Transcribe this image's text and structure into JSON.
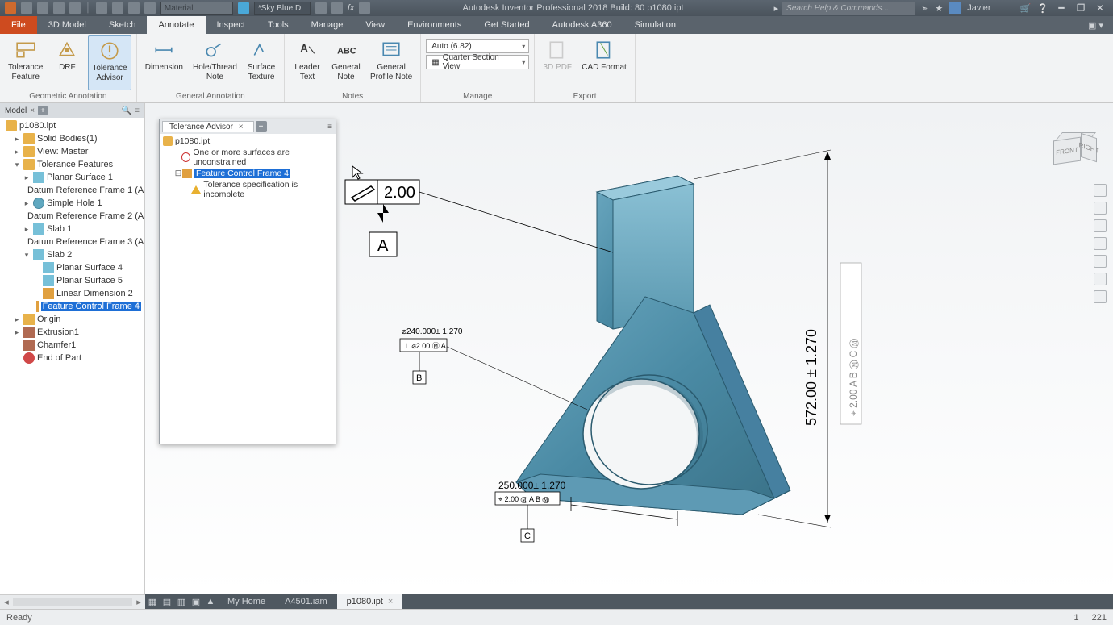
{
  "titlebar": {
    "material_placeholder": "Material",
    "appearance_label": "*Sky Blue D",
    "app_title": "Autodesk Inventor Professional 2018 Build: 80   p1080.ipt",
    "search_placeholder": "Search Help & Commands...",
    "user_name": "Javier"
  },
  "menu": {
    "file": "File",
    "tabs": [
      "3D Model",
      "Sketch",
      "Annotate",
      "Inspect",
      "Tools",
      "Manage",
      "View",
      "Environments",
      "Get Started",
      "Autodesk A360",
      "Simulation"
    ],
    "active_index": 2
  },
  "ribbon": {
    "groups": [
      {
        "label": "Geometric Annotation",
        "buttons": [
          {
            "name": "tolerance-feature",
            "label": "Tolerance\nFeature"
          },
          {
            "name": "drf",
            "label": "DRF"
          },
          {
            "name": "tolerance-advisor",
            "label": "Tolerance\nAdvisor",
            "active": true
          }
        ]
      },
      {
        "label": "General Annotation",
        "buttons": [
          {
            "name": "dimension",
            "label": "Dimension"
          },
          {
            "name": "hole-thread-note",
            "label": "Hole/Thread\nNote"
          },
          {
            "name": "surface-texture",
            "label": "Surface\nTexture"
          }
        ]
      },
      {
        "label": "Notes",
        "buttons": [
          {
            "name": "leader-text",
            "label": "Leader\nText"
          },
          {
            "name": "general-note",
            "label": "General\nNote"
          },
          {
            "name": "general-profile-note",
            "label": "General\nProfile Note"
          }
        ]
      },
      {
        "label": "Manage",
        "items": {
          "auto_dd": "Auto (6.82)",
          "section_dd": "Quarter Section View"
        }
      },
      {
        "label": "Export",
        "buttons": [
          {
            "name": "3d-pdf",
            "label": "3D PDF",
            "disabled": true
          },
          {
            "name": "cad-format",
            "label": "CAD Format"
          }
        ]
      }
    ]
  },
  "model_tree": {
    "tab": "Model",
    "root": "p1080.ipt",
    "nodes": [
      {
        "d": 1,
        "ico": "folder",
        "exp": ">",
        "label": "Solid Bodies(1)"
      },
      {
        "d": 1,
        "ico": "folder",
        "exp": ">",
        "label": "View: Master"
      },
      {
        "d": 1,
        "ico": "folder",
        "exp": "v",
        "label": "Tolerance Features"
      },
      {
        "d": 2,
        "ico": "planar",
        "exp": ">",
        "label": "Planar Surface 1"
      },
      {
        "d": 2,
        "ico": "drf",
        "exp": "",
        "label": "Datum Reference Frame 1 (A"
      },
      {
        "d": 2,
        "ico": "hole",
        "exp": ">",
        "label": "Simple Hole 1"
      },
      {
        "d": 2,
        "ico": "drf",
        "exp": "",
        "label": "Datum Reference Frame 2 (A"
      },
      {
        "d": 2,
        "ico": "slab",
        "exp": ">",
        "label": "Slab 1"
      },
      {
        "d": 2,
        "ico": "drf",
        "exp": "",
        "label": "Datum Reference Frame 3 (A"
      },
      {
        "d": 2,
        "ico": "slab",
        "exp": "v",
        "label": "Slab 2"
      },
      {
        "d": 3,
        "ico": "planar",
        "exp": "",
        "label": "Planar Surface 4"
      },
      {
        "d": 3,
        "ico": "planar",
        "exp": "",
        "label": "Planar Surface 5"
      },
      {
        "d": 3,
        "ico": "dim",
        "exp": "",
        "label": "Linear Dimension 2"
      },
      {
        "d": 3,
        "ico": "fcf",
        "exp": "",
        "label": "Feature Control Frame 4",
        "sel": true
      },
      {
        "d": 1,
        "ico": "origin",
        "exp": ">",
        "label": "Origin"
      },
      {
        "d": 1,
        "ico": "extrusion",
        "exp": ">",
        "label": "Extrusion1"
      },
      {
        "d": 1,
        "ico": "chamfer",
        "exp": "",
        "label": "Chamfer1"
      },
      {
        "d": 1,
        "ico": "end",
        "exp": "",
        "label": "End of Part"
      }
    ]
  },
  "advisor": {
    "tab": "Tolerance Advisor",
    "root": "p1080.ipt",
    "items": [
      {
        "ico": "err",
        "label": "One or more surfaces are unconstrained",
        "d": 1
      },
      {
        "ico": "fcf",
        "label": "Feature Control Frame 4",
        "sel": true,
        "d": 1,
        "exp": "-"
      },
      {
        "ico": "warn",
        "label": "Tolerance specification is incomplete",
        "d": 2
      }
    ]
  },
  "canvas": {
    "main_tol": {
      "value": "2.00",
      "datum": "A"
    },
    "dim_height": "572.00 ± 1.270",
    "dim_width": {
      "basic": "250.000± 1.270",
      "fcf": "⌖ 2.00 Ⓜ A B Ⓜ",
      "datum": "C"
    },
    "dim_hole": {
      "basic": "⌀240.000± 1.270",
      "fcf": "⊥ ⌀2.00 Ⓜ A",
      "datum": "B"
    },
    "side_fcf": "⌖ 2.00 A B Ⓜ C Ⓜ"
  },
  "viewcube": {
    "front": "FRONT",
    "right": "RIGHT"
  },
  "doctabs": {
    "tabs": [
      "My Home",
      "A4501.iam",
      "p1080.ipt"
    ],
    "active_index": 2
  },
  "status": {
    "left": "Ready",
    "num1": "1",
    "num2": "221"
  }
}
